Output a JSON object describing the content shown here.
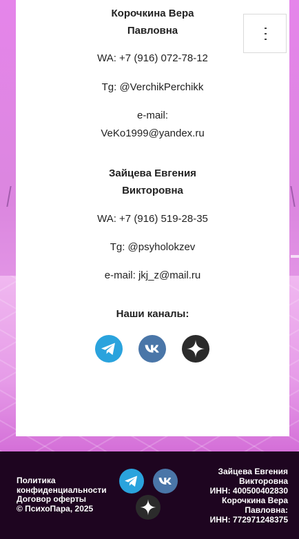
{
  "contacts": [
    {
      "name_line1": "Корочкина Вера",
      "name_line2": "Павловна",
      "whatsapp": "WA: +7 (916) 072-78-12",
      "telegram": "Tg: @VerchikPerchikk",
      "email_label": "e-mail:",
      "email": "VeKo1999@yandex.ru"
    },
    {
      "name_line1": "Зайцева Евгения",
      "name_line2": "Викторовна",
      "whatsapp": "WA: +7 (916) 519-28-35",
      "telegram": "Tg: @psyholokzev",
      "email_line": "e-mail: jkj_z@mail.ru"
    }
  ],
  "channels": {
    "title": "Наши каналы:",
    "icons": [
      "telegram-icon",
      "vk-icon",
      "dzen-icon"
    ]
  },
  "colors": {
    "telegram": "#2aa3dd",
    "vk": "#4a76a8",
    "dzen": "#2b2b2b",
    "footer_bg": "#1e0520"
  },
  "footer": {
    "links": [
      "Политика",
      "конфиденциальности",
      "Договор оферты",
      "© ПсихоПара, 2025"
    ],
    "legal": [
      "Зайцева Евгения",
      "Викторовна",
      "ИНН: 400500402830",
      "Корочкина Вера",
      "Павловна:",
      "ИНН: 772971248375"
    ]
  }
}
